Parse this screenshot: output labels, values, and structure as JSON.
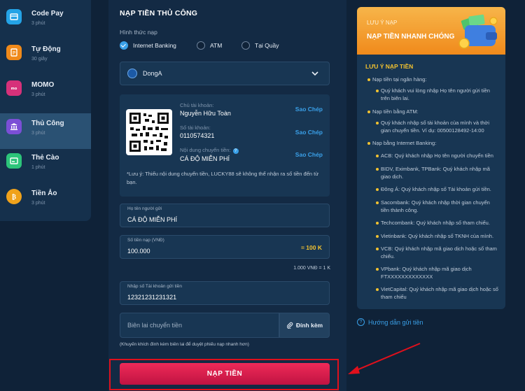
{
  "colors": {
    "accent": "#3aa0e8",
    "warning": "#f2c230",
    "submit": "#e8214f",
    "highlight": "#e0101c"
  },
  "sidebar": {
    "items": [
      {
        "label": "Code Pay",
        "sub": "3 phút",
        "icon": "code-pay-icon",
        "color": "#24a3e6"
      },
      {
        "label": "Tự Động",
        "sub": "30 giây",
        "icon": "auto-pay-icon",
        "color": "#f08a1b"
      },
      {
        "label": "MOMO",
        "sub": "3 phút",
        "icon": "momo-icon",
        "color": "#d6317a"
      },
      {
        "label": "Thủ Công",
        "sub": "3 phút",
        "icon": "bank-icon",
        "color": "#7b4fd6",
        "active": true
      },
      {
        "label": "Thẻ Cào",
        "sub": "1 phút",
        "icon": "card-icon",
        "color": "#2cc47a"
      },
      {
        "label": "Tiền Ảo",
        "sub": "3 phút",
        "icon": "bitcoin-icon",
        "color": "#f0a21b"
      }
    ]
  },
  "main": {
    "title": "NẠP TIỀN THỦ CÔNG",
    "method_label": "Hình thức nạp",
    "methods": [
      {
        "label": "Internet Banking",
        "selected": true
      },
      {
        "label": "ATM",
        "selected": false
      },
      {
        "label": "Tại Quầy",
        "selected": false
      }
    ],
    "bank": "DongA",
    "account": {
      "holder_label": "Chủ tài khoản:",
      "holder": "Nguyễn Hữu Toàn",
      "number_label": "Số tài khoản:",
      "number": "0110574321",
      "content_label": "Nội dung chuyển tiền:",
      "content": "CÁ ĐỘ MIỄN PHÍ",
      "copy_label": "Sao Chép"
    },
    "note": "*Lưu ý: Thiếu nội dung chuyển tiền, LUCKY88 sẽ không thể nhận ra số tiền đến từ bạn.",
    "sender": {
      "label": "Họ tên người gửi",
      "value": "CÁ ĐỘ MIỄN PHÍ"
    },
    "amount": {
      "label": "Số tiền nạp (VNĐ)",
      "value": "100.000",
      "equiv": "= 100 K"
    },
    "rate": "1.000 VNĐ = 1 K",
    "account_input": {
      "label": "Nhập số Tài khoản gửi tiền",
      "value": "12321231231321"
    },
    "receipt": {
      "placeholder": "Biên lai chuyển tiền",
      "attach_label": "Đính kèm"
    },
    "hint": "(Khuyến khích đính kèm biên lai để duyệt phiếu nạp nhanh hơn)",
    "submit_label": "NẠP TIỀN"
  },
  "notice": {
    "banner_small": "LƯU Ý NẠP",
    "banner_big": "NẠP TIỀN NHANH CHÓNG",
    "title": "LƯU Ý NẠP TIỀN",
    "items": [
      {
        "text": "Nạp tiền tại ngân hàng:",
        "level": 0
      },
      {
        "text": "Quý khách vui lòng nhập Họ tên người gửi tiền trên biên lai.",
        "level": 1
      },
      {
        "text": "Nạp tiền bằng ATM:",
        "level": 0
      },
      {
        "text": "Quý khách nhập số tài khoản của mình và thời gian chuyển tiền. Ví dụ: 00500128492-14:00",
        "level": 1
      },
      {
        "text": "Nạp bằng Internet Banking:",
        "level": 0
      },
      {
        "text": "ACB: Quý khách nhập Họ tên người chuyển tiền",
        "level": 1
      },
      {
        "text": "BIDV, Eximbank, TPBank: Quý khách nhập mã giao dịch.",
        "level": 1
      },
      {
        "text": "Đông Á: Quý khách nhập số Tài khoản gửi tiền.",
        "level": 1
      },
      {
        "text": "Sacombank: Quý khách nhập thời gian chuyển tiền thành công.",
        "level": 1
      },
      {
        "text": "Techcombank: Quý khách nhập số tham chiếu.",
        "level": 1
      },
      {
        "text": "Vietinbank: Quý khách nhập số TKNH của mình.",
        "level": 1
      },
      {
        "text": "VCB: Quý khách nhập mã giao dịch hoặc số tham chiếu.",
        "level": 1
      },
      {
        "text": "VPbank: Quý khách nhập mã giao dịch FTXXXXXXXXXXXXX",
        "level": 1
      },
      {
        "text": "VietCapital: Quý khách nhập mã giao dịch hoặc số tham chiếu",
        "level": 1
      }
    ]
  },
  "guide_label": "Hướng dẫn gửi tiền"
}
